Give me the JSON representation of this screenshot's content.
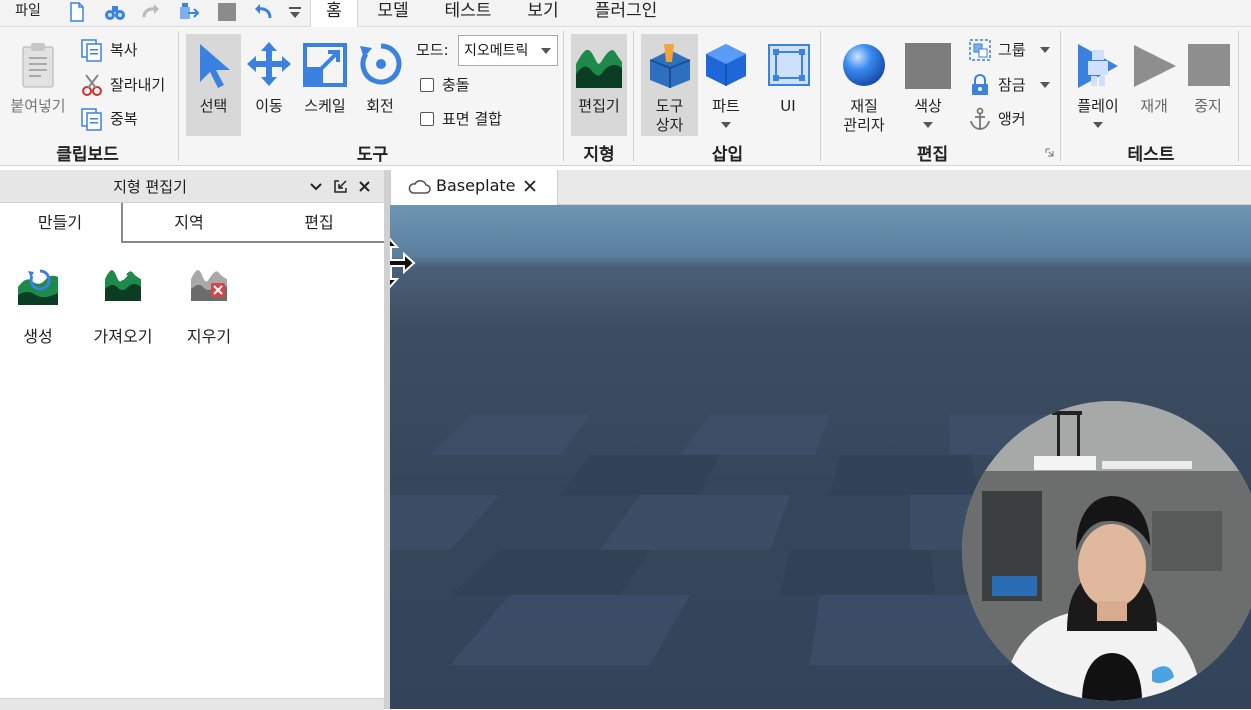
{
  "menubar": {
    "file": "파일",
    "tabs": [
      {
        "label": "홈",
        "active": true
      },
      {
        "label": "모델"
      },
      {
        "label": "테스트"
      },
      {
        "label": "보기"
      },
      {
        "label": "플러그인"
      }
    ],
    "quick_access_icons": [
      "new-file-icon",
      "binoculars-icon",
      "redo-icon",
      "export-icon",
      "stop-square-icon",
      "undo-icon",
      "customize-chevron-icon"
    ]
  },
  "ribbon": {
    "clipboard": {
      "group_label": "클립보드",
      "paste": "붙여넣기",
      "copy": "복사",
      "cut": "잘라내기",
      "duplicate": "중복"
    },
    "tools": {
      "group_label": "도구",
      "select": "선택",
      "move": "이동",
      "scale": "스케일",
      "rotate": "회전",
      "mode_label": "모드:",
      "mode_value": "지오메트릭",
      "collisions": "충돌",
      "join_surfaces": "표면 결합"
    },
    "terrain": {
      "group_label": "지형",
      "editor": "편집기"
    },
    "insert": {
      "group_label": "삽입",
      "toolbox_line1": "도구",
      "toolbox_line2": "상자",
      "part": "파트",
      "ui": "UI"
    },
    "edit": {
      "group_label": "편집",
      "material_line1": "재질",
      "material_line2": "관리자",
      "color": "색상",
      "group": "그룹",
      "lock": "잠금",
      "anchor": "앵커"
    },
    "test": {
      "group_label": "테스트",
      "play": "플레이",
      "resume": "재개",
      "stop": "중지"
    }
  },
  "terrain_panel": {
    "title": "지형 편집기",
    "tabs": [
      {
        "label": "만들기",
        "active": true
      },
      {
        "label": "지역"
      },
      {
        "label": "편집"
      }
    ],
    "tools": [
      {
        "label": "생성",
        "icon": "terrain-generate-icon"
      },
      {
        "label": "가져오기",
        "icon": "terrain-import-icon"
      },
      {
        "label": "지우기",
        "icon": "terrain-clear-icon"
      }
    ]
  },
  "document_tab": {
    "label": "Baseplate"
  },
  "colors": {
    "accent_blue": "#3b82e0",
    "terrain_green": "#1e8a4a",
    "viewport_sky": "#6d95b2",
    "viewport_ground": "#36465a"
  }
}
